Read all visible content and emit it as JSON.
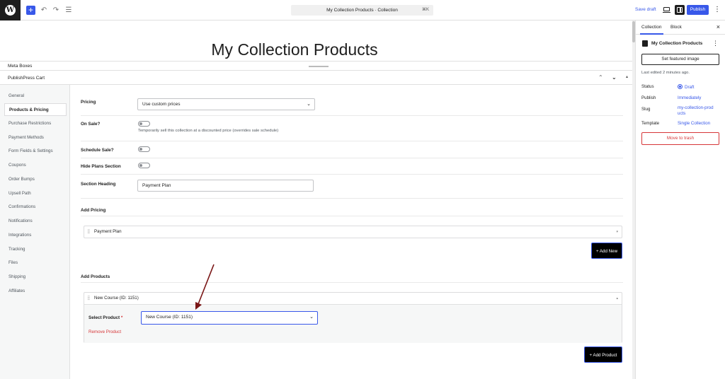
{
  "topbar": {
    "command_search": "My Collection Products · Collection",
    "shortcut": "⌘K",
    "save_draft": "Save draft",
    "publish": "Publish"
  },
  "post": {
    "title": "My Collection Products"
  },
  "metaboxes": {
    "label": "Meta Boxes"
  },
  "cart": {
    "title": "PublishPress Cart",
    "nav": [
      "General",
      "Products & Pricing",
      "Purchase Restrictions",
      "Payment Methods",
      "Form Fields & Settings",
      "Coupons",
      "Order Bumps",
      "Upsell Path",
      "Confirmations",
      "Notifications",
      "Integrations",
      "Tracking",
      "Files",
      "Shipping",
      "Affiliates"
    ],
    "active_nav": "Products & Pricing",
    "pricing_label": "Pricing",
    "pricing_value": "Use custom prices",
    "on_sale_label": "On Sale?",
    "on_sale_help": "Temporarily sell this collection at a discounted price (overrides sale schedule)",
    "schedule_sale_label": "Schedule Sale?",
    "hide_plans_label": "Hide Plans Section",
    "section_heading_label": "Section Heading",
    "section_heading_value": "Payment Plan",
    "add_pricing_title": "Add Pricing",
    "pricing_item": "Payment Plan",
    "add_new_button": "+ Add New",
    "add_products_title": "Add Products",
    "product_item": "New Course (ID: 1151)",
    "select_product_label": "Select Product",
    "required_mark": "*",
    "select_product_value": "New Course (ID: 1151)",
    "remove_product": "Remove Product",
    "add_product_button": "+ Add Product"
  },
  "sidebar": {
    "tabs": [
      "Collection",
      "Block"
    ],
    "title": "My Collection Products",
    "featured_image": "Set featured image",
    "last_edited": "Last edited 2 minutes ago.",
    "rows": [
      {
        "label": "Status",
        "value": "Draft"
      },
      {
        "label": "Publish",
        "value": "Immediately"
      },
      {
        "label": "Slug",
        "value": "my-collection-products"
      },
      {
        "label": "Template",
        "value": "Single Collection"
      }
    ],
    "trash": "Move to trash"
  },
  "colors": {
    "accent": "#3858e9",
    "danger": "#d63638",
    "annotation_arrow": "#7a1616"
  }
}
